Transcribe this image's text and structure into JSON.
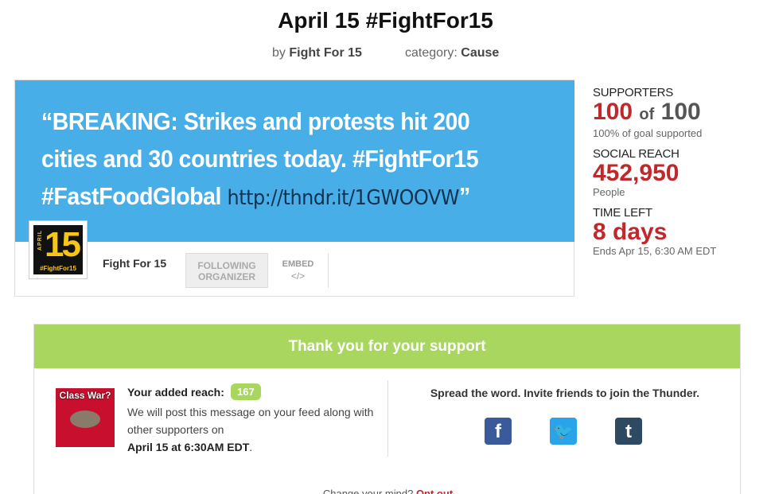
{
  "header": {
    "title": "April 15 #FightFor15",
    "by_label": "by",
    "by_name": "Fight For 15",
    "category_label": "category:",
    "category_value": "Cause"
  },
  "message": {
    "quote_text": "“BREAKING: Strikes and protests hit 200 cities and 30 countries today. #FightFor15 #FastFoodGlobal ",
    "quote_link": "http://thndr.it/1GWOOVW",
    "quote_close": "”"
  },
  "organizer": {
    "avatar_april": "APRIL",
    "avatar_number": "15",
    "avatar_tag": "#FightFor15",
    "name": "Fight For 15",
    "following_label": "FOLLOWING ORGANIZER",
    "embed_label": "EMBED",
    "embed_icon": "</>"
  },
  "stats": {
    "supporters_label": "SUPPORTERS",
    "supporters_count": "100",
    "supporters_of": "of",
    "supporters_goal": "100",
    "supporters_sub": "100% of goal supported",
    "reach_label": "SOCIAL REACH",
    "reach_value": "452,950",
    "reach_sub": "People",
    "time_label": "TIME LEFT",
    "time_value": "8 days",
    "time_sub": "Ends Apr 15, 6:30 AM EDT"
  },
  "support": {
    "heading": "Thank you for your support",
    "thumb_text": "Class War?",
    "added_reach_label": "Your added reach:",
    "added_reach_value": "167",
    "desc_line": "We will post this message on your feed along with other supporters on",
    "desc_date": "April 15 at 6:30AM EDT",
    "desc_end": ".",
    "spread_text": "Spread the word. Invite friends to join the Thunder.",
    "facebook_glyph": "f",
    "twitter_glyph": "🐦",
    "tumblr_glyph": "t",
    "optout_text": "Change your mind?",
    "optout_link": "Opt out"
  },
  "colors": {
    "accent_blue": "#48aee8",
    "accent_green": "#a9d65f",
    "stat_red": "#c0282b"
  }
}
